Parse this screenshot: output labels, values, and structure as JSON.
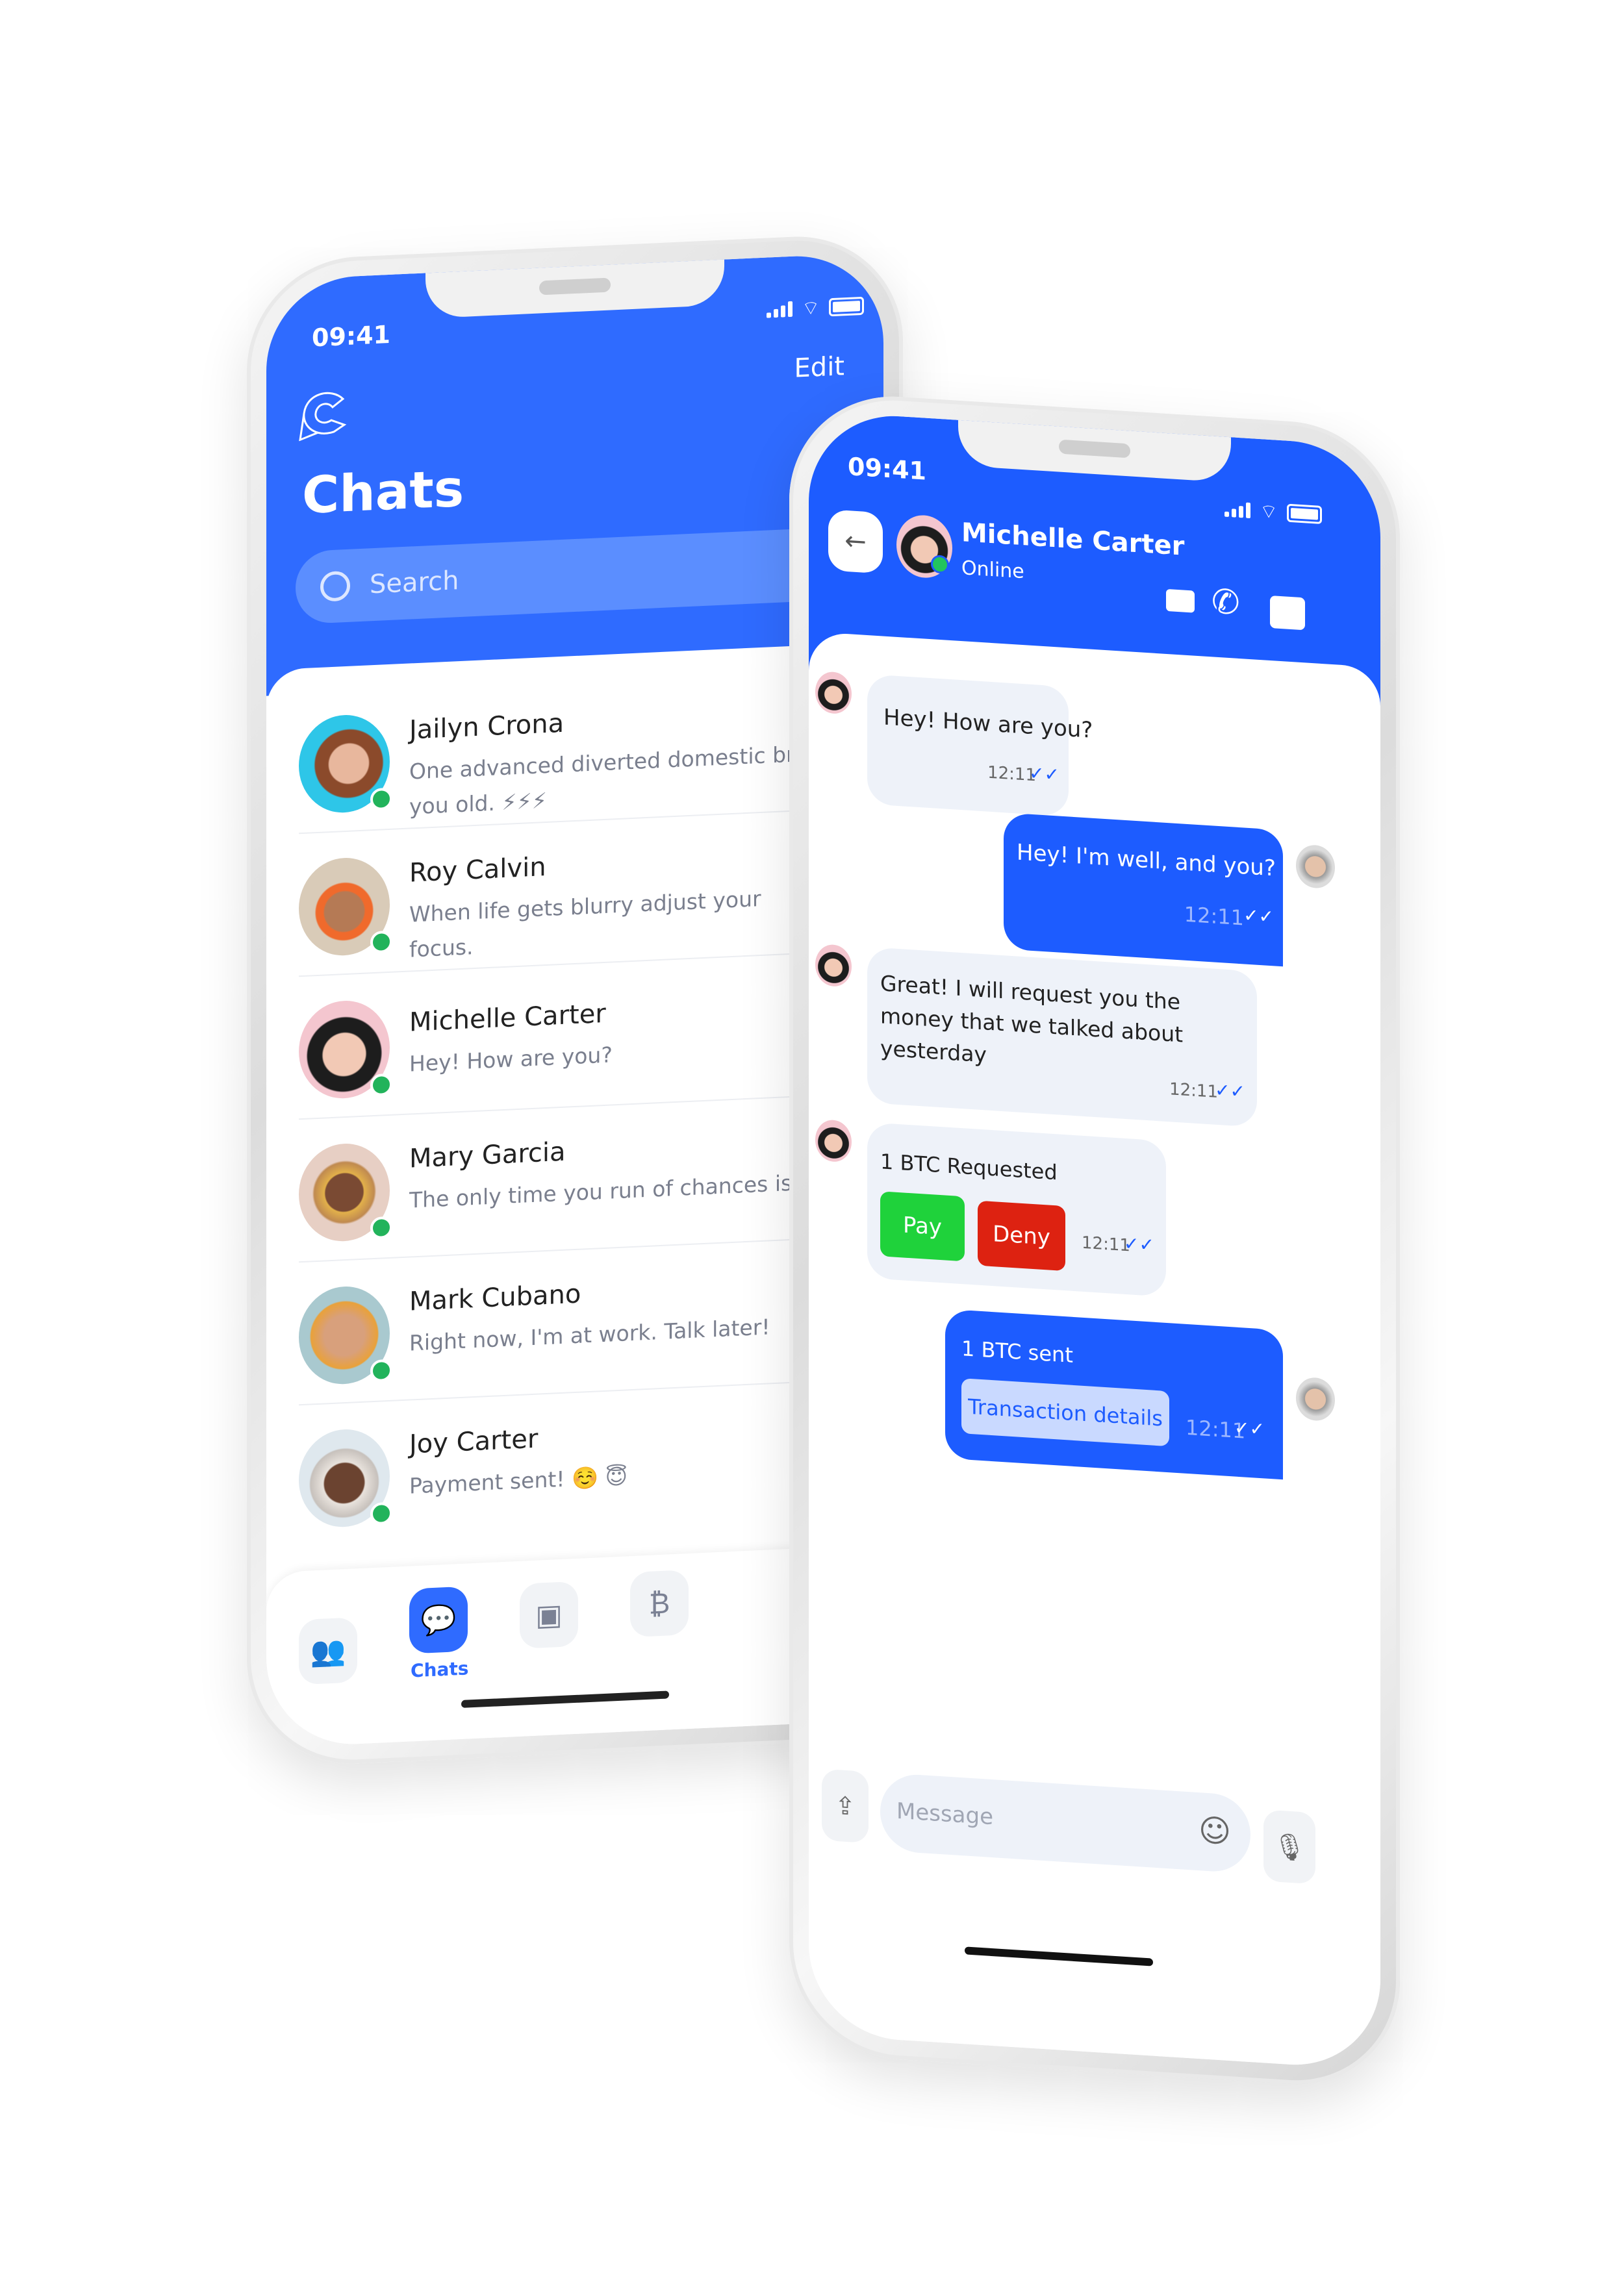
{
  "status_bar": {
    "time": "09:41"
  },
  "chats_screen": {
    "edit_label": "Edit",
    "title": "Chats",
    "search_placeholder": "Search",
    "chats": [
      {
        "name": "Jailyn Crona",
        "preview": "One advanced diverted domestic bringing you old. ⚡⚡⚡",
        "online": true
      },
      {
        "name": "Roy Calvin",
        "preview": "When life gets blurry adjust your focus.",
        "online": true
      },
      {
        "name": "Michelle Carter",
        "preview": "Hey! How are you?",
        "online": true
      },
      {
        "name": "Mary Garcia",
        "preview": "The only time you run of chances is when you stop taking them.",
        "online": true
      },
      {
        "name": "Mark Cubano",
        "preview": "Right now, I'm at work. Talk later!",
        "online": true
      },
      {
        "name": "Joy Carter",
        "preview": "Payment sent! ☺️ 😇",
        "online": true
      }
    ],
    "nav": {
      "active_label": "Chats",
      "items": [
        "contacts-icon",
        "chat-icon",
        "wallet-icon",
        "bitcoin-lock-icon"
      ]
    }
  },
  "conversation": {
    "contact_name": "Michelle Carter",
    "contact_status": "Online",
    "messages": [
      {
        "from": "them",
        "text": "Hey! How are you?",
        "time": "12:11"
      },
      {
        "from": "me",
        "text": "Hey! I'm well, and you?",
        "time": "12:11"
      },
      {
        "from": "them",
        "text": "Great! I will request you the money that we talked about yesterday",
        "time": "12:11"
      },
      {
        "from": "them",
        "text": "1 BTC Requested",
        "time": "12:11",
        "pay_label": "Pay",
        "deny_label": "Deny"
      },
      {
        "from": "me",
        "text": "1 BTC sent",
        "time": "12:11",
        "details_label": "Transaction details"
      }
    ],
    "input_placeholder": "Message"
  },
  "colors": {
    "brand": "#2f6bff",
    "chat_blue": "#1d5cff",
    "pay": "#1fd23b",
    "deny": "#dd2211",
    "online": "#22b35b"
  }
}
